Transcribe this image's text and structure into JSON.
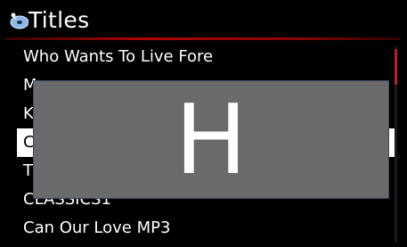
{
  "header": {
    "title": "Titles",
    "icon": "disc-music-icon"
  },
  "list": {
    "items": [
      {
        "label": "Who Wants To Live Fore",
        "selected": false
      },
      {
        "label": "M",
        "selected": false
      },
      {
        "label": "K",
        "selected": false
      },
      {
        "label": "C",
        "selected": true
      },
      {
        "label": "T",
        "selected": false
      },
      {
        "label": "CLASSICS1",
        "selected": false
      },
      {
        "label": "Can Our Love MP3",
        "selected": false
      }
    ]
  },
  "jump_overlay": {
    "letter": "H"
  },
  "colors": {
    "background": "#000000",
    "accent_red": "#b00000",
    "overlay_gray": "#6a6a6a",
    "selection": "#ffffff"
  }
}
